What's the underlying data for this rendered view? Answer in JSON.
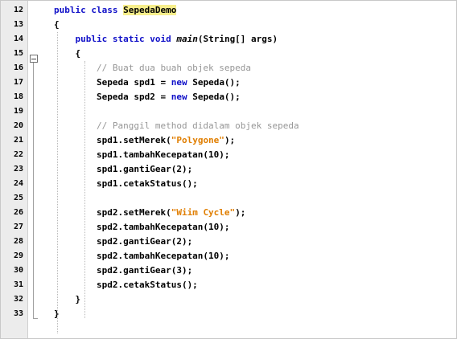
{
  "editor": {
    "lines": [
      {
        "num": "12",
        "segs": [
          [
            "public class ",
            "kw"
          ],
          [
            "SepedaDemo",
            "hl"
          ]
        ]
      },
      {
        "num": "13",
        "segs": [
          [
            "{",
            ""
          ]
        ]
      },
      {
        "num": "14",
        "segs": [
          [
            "    public static void ",
            "kw"
          ],
          [
            "main",
            "it"
          ],
          [
            "(String[] args)",
            ""
          ]
        ]
      },
      {
        "num": "15",
        "segs": [
          [
            "    {",
            ""
          ]
        ]
      },
      {
        "num": "16",
        "segs": [
          [
            "        // Buat dua buah objek sepeda",
            "cm"
          ]
        ]
      },
      {
        "num": "17",
        "segs": [
          [
            "        Sepeda spd1 = ",
            ""
          ],
          [
            "new",
            "kw"
          ],
          [
            " Sepeda();",
            ""
          ]
        ]
      },
      {
        "num": "18",
        "segs": [
          [
            "        Sepeda spd2 = ",
            ""
          ],
          [
            "new",
            "kw"
          ],
          [
            " Sepeda();",
            ""
          ]
        ]
      },
      {
        "num": "19",
        "segs": []
      },
      {
        "num": "20",
        "segs": [
          [
            "        // Panggil method didalam objek sepeda",
            "cm"
          ]
        ]
      },
      {
        "num": "21",
        "segs": [
          [
            "        spd1.setMerek(",
            ""
          ],
          [
            "\"Polygone\"",
            "str"
          ],
          [
            ");",
            ""
          ]
        ]
      },
      {
        "num": "22",
        "segs": [
          [
            "        spd1.tambahKecepatan(10);",
            ""
          ]
        ]
      },
      {
        "num": "23",
        "segs": [
          [
            "        spd1.gantiGear(2);",
            ""
          ]
        ]
      },
      {
        "num": "24",
        "segs": [
          [
            "        spd1.cetakStatus();",
            ""
          ]
        ]
      },
      {
        "num": "25",
        "segs": []
      },
      {
        "num": "26",
        "segs": [
          [
            "        spd2.setMerek(",
            ""
          ],
          [
            "\"Wiim Cycle\"",
            "str"
          ],
          [
            ");",
            ""
          ]
        ]
      },
      {
        "num": "27",
        "segs": [
          [
            "        spd2.tambahKecepatan(10);",
            ""
          ]
        ]
      },
      {
        "num": "28",
        "segs": [
          [
            "        spd2.gantiGear(2);",
            ""
          ]
        ]
      },
      {
        "num": "29",
        "segs": [
          [
            "        spd2.tambahKecepatan(10);",
            ""
          ]
        ]
      },
      {
        "num": "30",
        "segs": [
          [
            "        spd2.gantiGear(3);",
            ""
          ]
        ]
      },
      {
        "num": "31",
        "segs": [
          [
            "        spd2.cetakStatus();",
            ""
          ]
        ]
      },
      {
        "num": "32",
        "segs": [
          [
            "    }",
            ""
          ]
        ]
      },
      {
        "num": "33",
        "segs": [
          [
            "}",
            ""
          ]
        ]
      }
    ],
    "fold_icon": "collapse-minus-icon"
  }
}
